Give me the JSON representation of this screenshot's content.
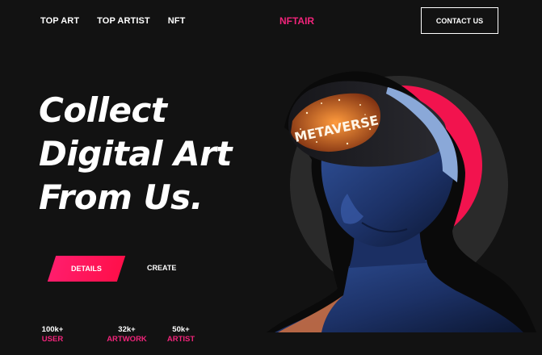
{
  "nav": {
    "items": [
      "TOP ART",
      "TOP ARTIST",
      "NFT"
    ]
  },
  "brand": "NFTAIR",
  "contact_label": "CONTACT US",
  "headline": [
    "Collect",
    "Digital Art",
    "From Us."
  ],
  "buttons": {
    "details": "DETAILS",
    "create": "CREATE"
  },
  "stats": [
    {
      "value": "100k+",
      "label": "USER"
    },
    {
      "value": "32k+",
      "label": "ARTWORK"
    },
    {
      "value": "50k+",
      "label": "ARTIST"
    }
  ],
  "hero": {
    "headset_text": "METAVERSE"
  },
  "colors": {
    "accent": "#f0247a",
    "background": "#121212"
  }
}
